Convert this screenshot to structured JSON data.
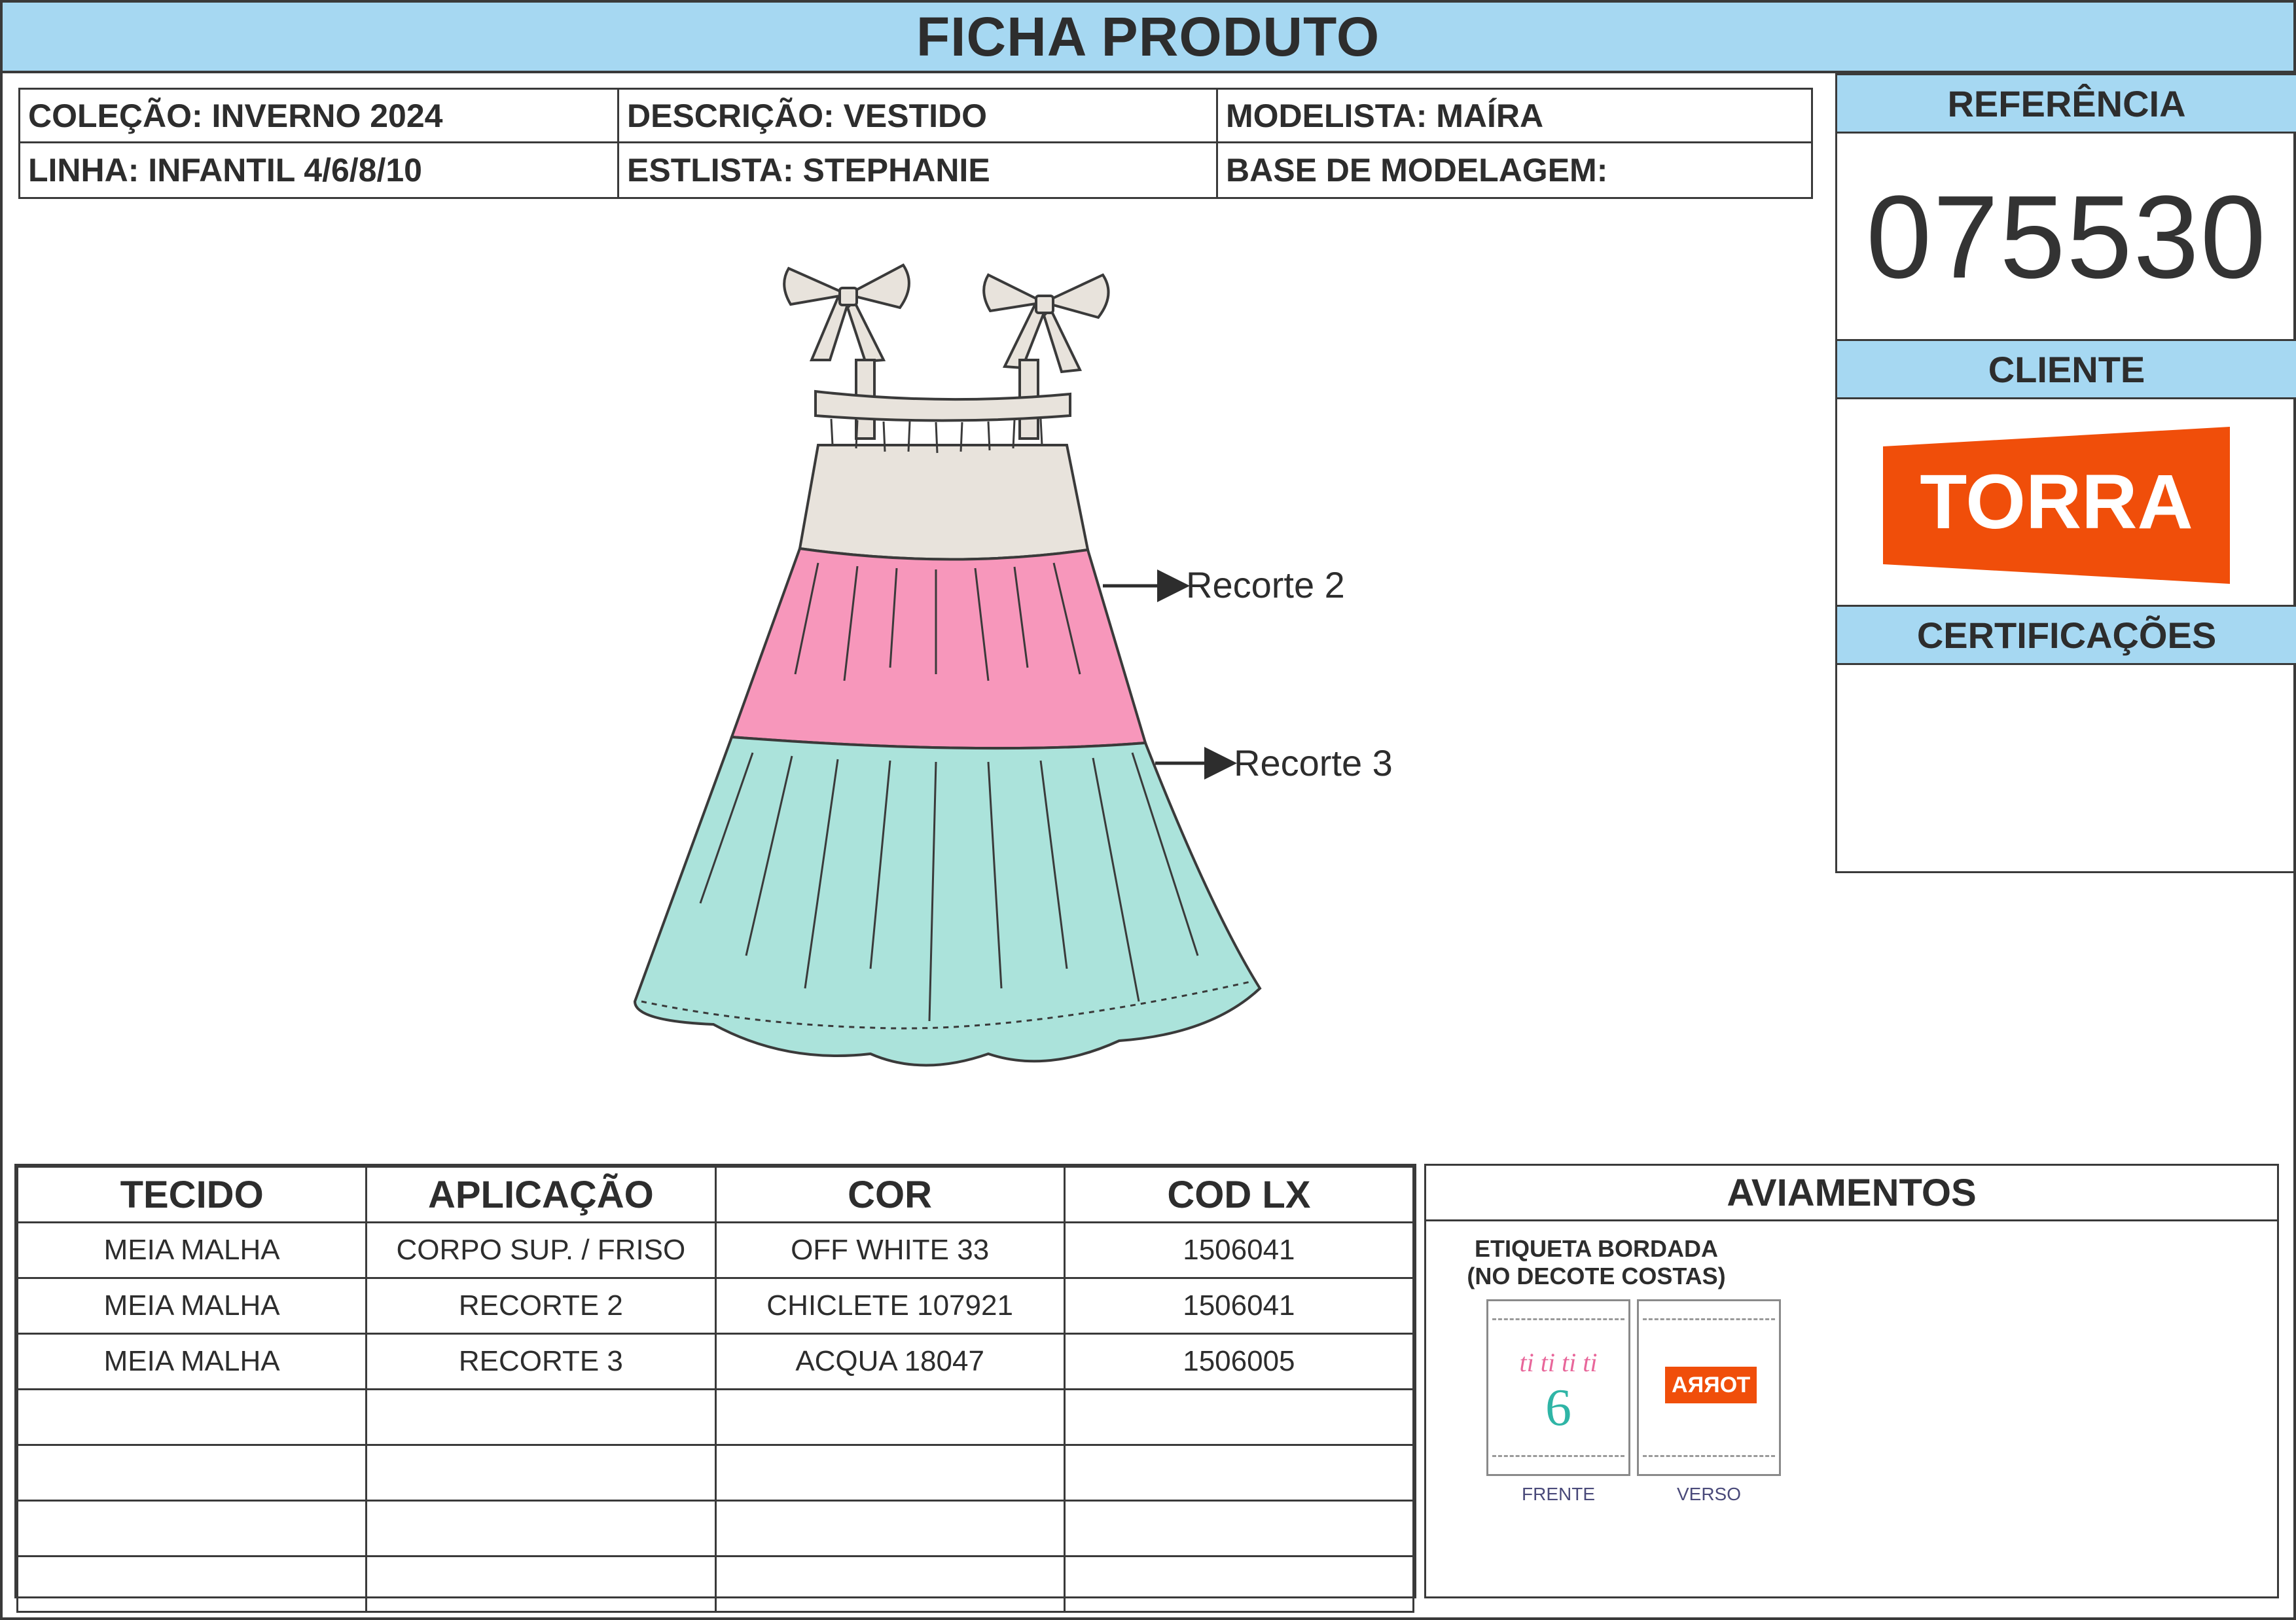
{
  "title": "FICHA PRODUTO",
  "info": {
    "colecao": "COLEÇÃO: INVERNO 2024",
    "descricao": "DESCRIÇÃO: VESTIDO",
    "modelista": "MODELISTA: MAÍRA",
    "linha": "LINHA: INFANTIL 4/6/8/10",
    "estilista": "ESTLISTA: STEPHANIE",
    "base": "BASE DE MODELAGEM:"
  },
  "panel": {
    "referencia_label": "REFERÊNCIA",
    "referencia_value": "075530",
    "cliente_label": "CLIENTE",
    "cliente_logo_text": "TORRA",
    "certificacoes_label": "CERTIFICAÇÕES"
  },
  "colors": {
    "header_blue": "#a6d8f2",
    "off_white": "#e8e3dc",
    "chiclete": "#f797bb",
    "acqua": "#abe3db",
    "torra_orange": "#f04e0a"
  },
  "callouts": {
    "recorte2": "Recorte 2",
    "recorte3": "Recorte 3"
  },
  "table": {
    "headers": [
      "TECIDO",
      "APLICAÇÃO",
      "COR",
      "COD LX"
    ],
    "rows": [
      [
        "MEIA MALHA",
        "CORPO SUP. / FRISO",
        "OFF WHITE 33",
        "1506041"
      ],
      [
        "MEIA MALHA",
        "RECORTE 2",
        "CHICLETE 107921",
        "1506041"
      ],
      [
        "MEIA MALHA",
        "RECORTE 3",
        "ACQUA 18047",
        "1506005"
      ],
      [
        "",
        "",
        "",
        ""
      ],
      [
        "",
        "",
        "",
        ""
      ],
      [
        "",
        "",
        "",
        ""
      ],
      [
        "",
        "",
        "",
        ""
      ]
    ]
  },
  "aviamentos": {
    "title": "AVIAMENTOS",
    "item_label": "ETIQUETA BORDADA\n(NO DECOTE COSTAS)",
    "item_label_line1": "ETIQUETA BORDADA",
    "item_label_line2": "(NO DECOTE COSTAS)",
    "front_caption": "FRENTE",
    "back_caption": "VERSO",
    "front_tag_text": "ti ti ti ti",
    "front_tag_size": "6",
    "back_tag_text": "TORRA"
  }
}
